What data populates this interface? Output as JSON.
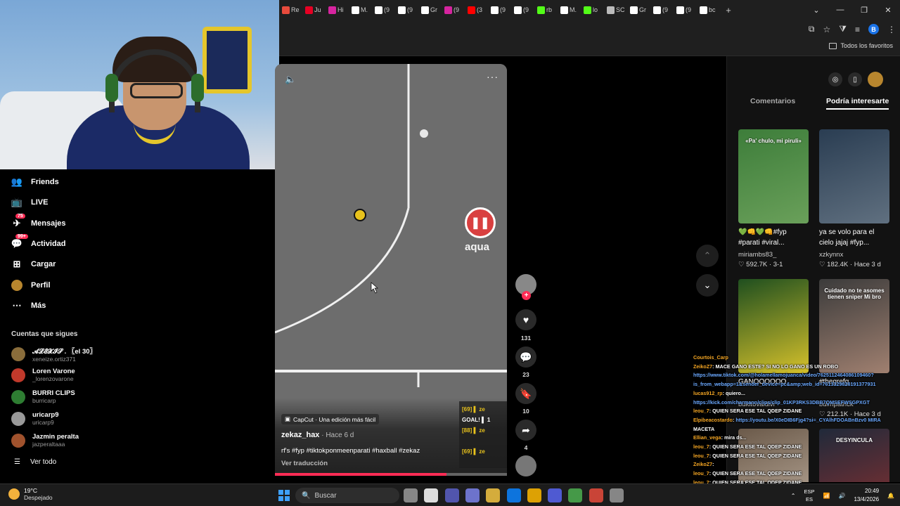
{
  "browser": {
    "tabs": [
      {
        "label": "Re",
        "color": "#e84b3c"
      },
      {
        "label": "Ju",
        "color": "#e60023"
      },
      {
        "label": "Hi",
        "color": "#d6249f"
      },
      {
        "label": "M.",
        "color": "#ffffff"
      },
      {
        "label": "(9",
        "color": "#ffffff"
      },
      {
        "label": "(9",
        "color": "#ffffff"
      },
      {
        "label": "Gr",
        "color": "#ffffff"
      },
      {
        "label": "(9",
        "color": "#d6249f"
      },
      {
        "label": "(3",
        "color": "#ff0000"
      },
      {
        "label": "(9",
        "color": "#ffffff"
      },
      {
        "label": "(9",
        "color": "#ffffff"
      },
      {
        "label": "rb",
        "color": "#53fc18"
      },
      {
        "label": "M.",
        "color": "#ffffff"
      },
      {
        "label": "lo",
        "color": "#53fc18"
      },
      {
        "label": "SC",
        "color": "#bbbbbb"
      },
      {
        "label": "Gr",
        "color": "#ffffff"
      },
      {
        "label": "(9",
        "color": "#ffffff"
      },
      {
        "label": "(9",
        "color": "#ffffff"
      },
      {
        "label": "bc",
        "color": "#ffffff"
      }
    ],
    "new_tab": "+",
    "profile_letter": "B",
    "bookmarks_all": "Todos los favoritos"
  },
  "nav": {
    "items": [
      {
        "label": "Friends",
        "icon": "friends-icon",
        "glyph": "👥"
      },
      {
        "label": "LIVE",
        "icon": "live-icon",
        "glyph": "📺"
      },
      {
        "label": "Mensajes",
        "icon": "messages-icon",
        "glyph": "✈",
        "badge": "75"
      },
      {
        "label": "Actividad",
        "icon": "activity-icon",
        "glyph": "💬",
        "badge": "99+"
      },
      {
        "label": "Cargar",
        "icon": "upload-icon",
        "glyph": "⊞"
      },
      {
        "label": "Perfil",
        "icon": "profile-avatar-icon",
        "glyph": ""
      },
      {
        "label": "Más",
        "icon": "more-icon",
        "glyph": "⋯"
      }
    ],
    "following_title": "Cuentas que sigues",
    "accounts": [
      {
        "name": "𝓐𝓛𝓔𝓧𝓘𝓢 . 〖el 30〗",
        "handle": "xeneize.ortiz371",
        "color": "#8a6d3b"
      },
      {
        "name": "Loren Varone",
        "handle": "_lorenzovarone",
        "color": "#c0392b"
      },
      {
        "name": "BURRI CLIPS",
        "handle": "burricarp",
        "color": "#2e7d32"
      },
      {
        "name": "uricarp9",
        "handle": "uricarp9",
        "color": "#999999"
      },
      {
        "name": "Jazmin peralta",
        "handle": "jazperaltaaa",
        "color": "#a0522d"
      }
    ],
    "see_all": "Ver todo"
  },
  "video": {
    "pause_label": "aqua",
    "capcut": "CapCut · Una edición más fácil",
    "author": "zekaz_hax",
    "date": " · Hace 6 d",
    "description": "rf's #fyp #tiktokponmeenparati #haxball #zekaz",
    "translate": "Ver traducción",
    "scoreboard": [
      "[69] ▌ ze",
      "GOAL! ▌ 1",
      "[88] ▌ ze",
      "",
      "[69] ▌ ze"
    ],
    "progress": 0.74
  },
  "actions": {
    "likes": "131",
    "comments": "23",
    "saves": "10",
    "shares": "4"
  },
  "panel": {
    "tab_comments": "Comentarios",
    "tab_related": "Podría interesarte",
    "cards": [
      {
        "caption": "«Pa' chulo, mi piruli»",
        "title": "💚👊💚👊#fyp #parati #viral...",
        "author": "miriambs83_",
        "likes": "592.7K",
        "date": "3-1",
        "colors": [
          "#3d7d3a",
          "#6aa05a"
        ]
      },
      {
        "caption": "",
        "title": "ya se volo para el cielo jajaj #fyp...",
        "author": "xzkynnx",
        "likes": "182.4K",
        "date": "Hace 3 d",
        "colors": [
          "#2a3d52",
          "#607080"
        ]
      },
      {
        "caption": "",
        "title": "GANOOOOOO",
        "author": "bukitovaldivi",
        "likes": "",
        "date": "",
        "colors": [
          "#1f4f1f",
          "#d6c12b"
        ]
      },
      {
        "caption": "Cuidado no te asomes tienen sniper Mi bro",
        "title": "#thegrefg...",
        "author": "bulmpatrick",
        "likes": "212.1K",
        "date": "Hace 3 d",
        "colors": [
          "#3b3b3b",
          "#a08070"
        ]
      },
      {
        "caption": "",
        "title": "",
        "author": "",
        "likes": "",
        "date": "",
        "colors": [
          "#6b5a4a",
          "#c0b0a0"
        ]
      },
      {
        "caption": "DESYINCULA",
        "title": "",
        "author": "",
        "likes": "",
        "date": "",
        "colors": [
          "#202a3a",
          "#8a3030"
        ]
      }
    ]
  },
  "chat": [
    {
      "user": "Courtois_Carp",
      "msg": "",
      "link": ""
    },
    {
      "user": "ZeikoZ7",
      "msg": ": MACE GANO ESTE? SI NO LO GANO ES UN ROBO",
      "link": ""
    },
    {
      "user": "",
      "msg": "",
      "link": "https://www.tiktok.com/@holamellamojuanca/video/7625112464086109460?"
    },
    {
      "user": "",
      "msg": "",
      "link": "is_from_webapp=1&sender_device=pc&amp;web_id=7613329826191377931"
    },
    {
      "user": "lucas912_rp",
      "msg": ": quiero...",
      "link": ""
    },
    {
      "user": "",
      "msg": "",
      "link": "https://kick.com/charmann/clips/clip_01KP3RKS3DBB7QMSEFWSGPXGT"
    },
    {
      "user": "leou_7",
      "msg": ": QUIEN SERA ESE TAL QDEP ZIDANE",
      "link": ""
    },
    {
      "user": "Elpibeacostardo",
      "msg": ": ",
      "link": "https://youtu.be/X0eDIB6Fjg4?si=_CYAlhFDOABnBzv0  MIRA"
    },
    {
      "user": "",
      "msg": "MACETA",
      "link": ""
    },
    {
      "user": "Ellian_vega",
      "msg": ": mira ds...",
      "link": ""
    },
    {
      "user": "leou_7",
      "msg": ": QUIEN SERA ESE TAL QDEP ZIDANE",
      "link": ""
    },
    {
      "user": "leou_7",
      "msg": ": QUIEN SERA ESE TAL QDEP ZIDANE",
      "link": ""
    },
    {
      "user": "ZeikoZ7",
      "msg": ": ",
      "link": ""
    },
    {
      "user": "leou_7",
      "msg": ": QUIEN SERA ESE TAL QDEP ZIDANE",
      "link": ""
    },
    {
      "user": "leou_7",
      "msg": ": QUIEN SERA ESE TAL QDEP ZIDANE",
      "link": ""
    },
    {
      "user": "Ellian_vega",
      "msg": ": mira ds...",
      "link": ""
    }
  ],
  "taskbar": {
    "temp": "19°C",
    "condition": "Despejado",
    "search": "Buscar",
    "lang1": "ESP",
    "lang2": "ES",
    "time": "20:49",
    "date": "13/4/2026",
    "apps": [
      "#9a9a9a",
      "#ffffff",
      "#5b5fc7",
      "#7b83eb",
      "#f4c542",
      "#0a84ff",
      "#ffb900",
      "#5865f2",
      "#4caf50",
      "#e84b3c",
      "#999999"
    ]
  }
}
